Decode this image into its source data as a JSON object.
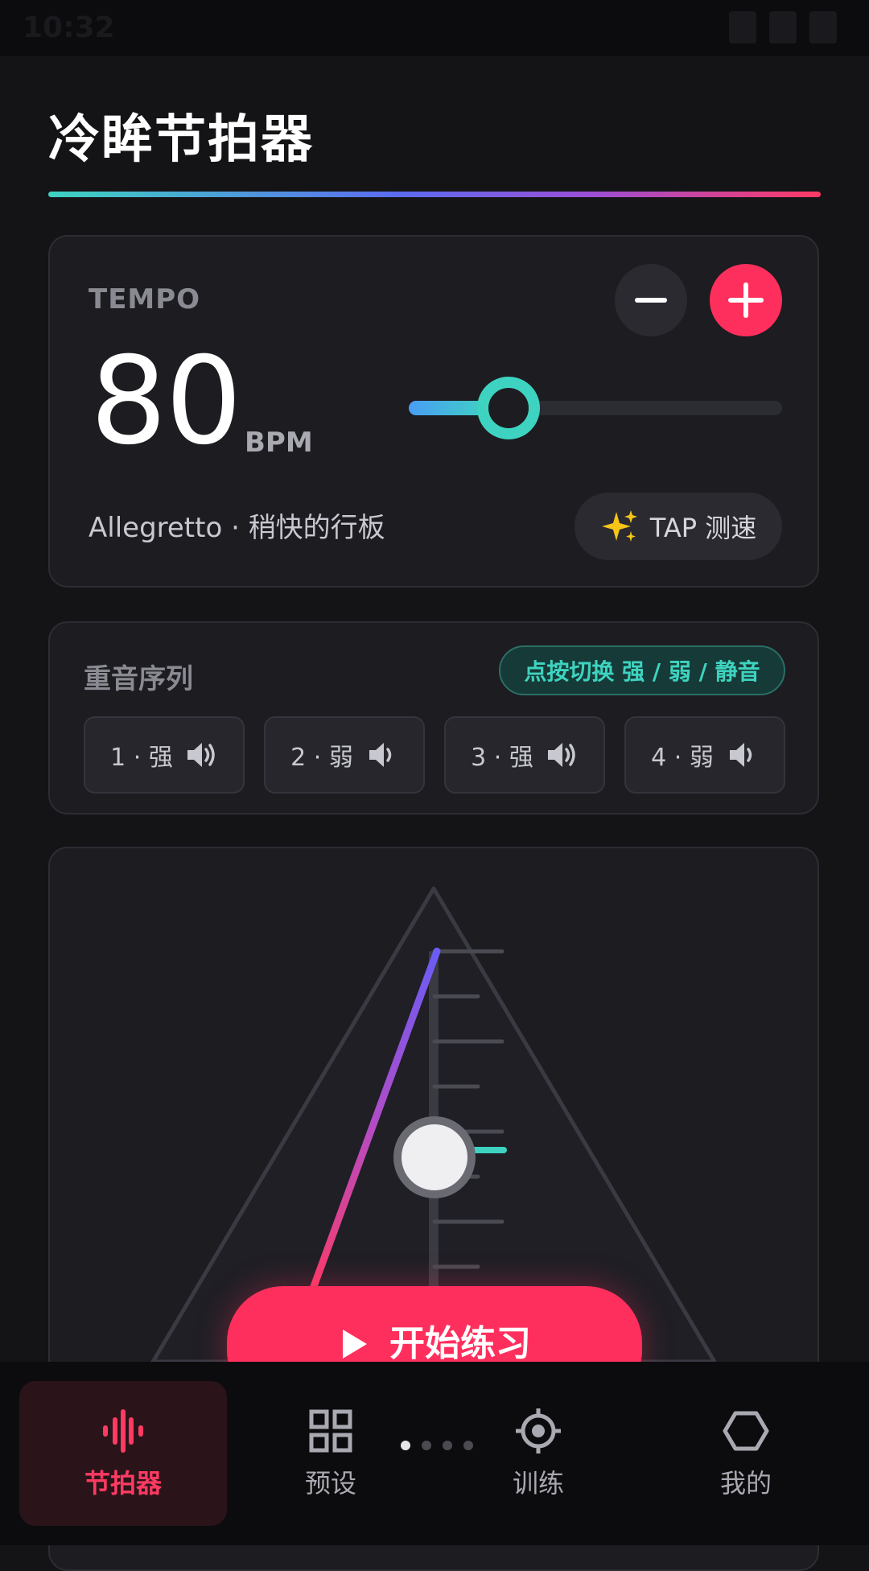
{
  "status_bar": {
    "time": "10:32"
  },
  "title": "冷眸节拍器",
  "tempo": {
    "label": "TEMPO",
    "bpm": "80",
    "unit": "BPM",
    "slider_fraction": 0.2,
    "tempo_name": "Allegretto · 稍快的行板",
    "tap_label": "TAP 测速",
    "minus_icon": "minus-icon",
    "plus_icon": "plus-icon"
  },
  "accent": {
    "title": "重音序列",
    "hint": "点按切换 强 / 弱 / 静音",
    "beats": [
      {
        "label": "1 · 强",
        "level": "strong"
      },
      {
        "label": "2 · 弱",
        "level": "weak"
      },
      {
        "label": "3 · 强",
        "level": "strong"
      },
      {
        "label": "4 · 弱",
        "level": "weak"
      }
    ]
  },
  "start_button": {
    "label": "开始练习",
    "icon": "play-icon"
  },
  "pager": {
    "count": 4,
    "active": 0
  },
  "nav": [
    {
      "label": "节拍器",
      "icon": "waveform-icon",
      "active": true
    },
    {
      "label": "预设",
      "icon": "grid-icon",
      "active": false
    },
    {
      "label": "训练",
      "icon": "target-icon",
      "active": false
    },
    {
      "label": "我的",
      "icon": "hexagon-icon",
      "active": false
    }
  ],
  "colors": {
    "accent": "#ff2f5d",
    "teal": "#3ed3c0",
    "background": "#141417"
  }
}
